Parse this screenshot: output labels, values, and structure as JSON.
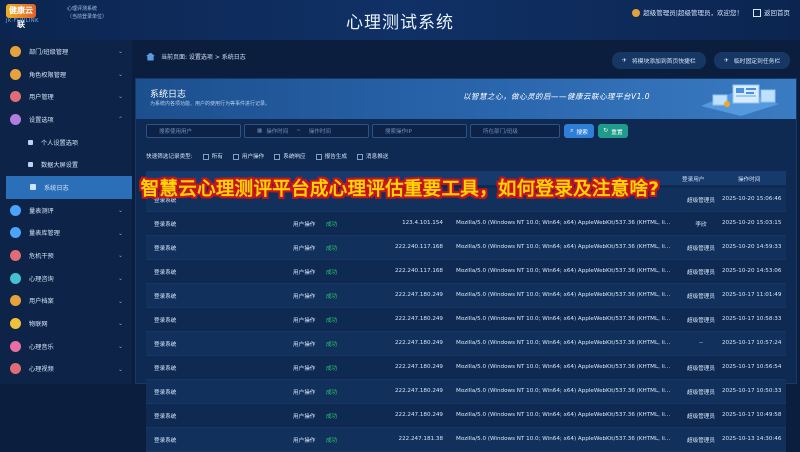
{
  "header": {
    "logo_text": "健康云联",
    "logo_sub": "JK·FUNLINK",
    "system_line1": "心理评测系统",
    "system_line2": "（当前登录单位）",
    "title": "心理测试系统",
    "user_label": "超级管理员|超级管理员，欢迎您！",
    "home_label": "返回首页"
  },
  "sidebar": {
    "items": [
      {
        "label": "部门/班级管理",
        "color": "#e6a23c"
      },
      {
        "label": "角色权限管理",
        "color": "#e6a23c"
      },
      {
        "label": "用户管理",
        "color": "#e06c75"
      },
      {
        "label": "设置选项",
        "color": "#b07de0"
      },
      {
        "label": "个人设置选项"
      },
      {
        "label": "数据大屏设置"
      },
      {
        "label": "系统日志"
      },
      {
        "label": "量表测评",
        "color": "#4aa3ff"
      },
      {
        "label": "量表库管理",
        "color": "#4aa3ff"
      },
      {
        "label": "危机干预",
        "color": "#e06c75"
      },
      {
        "label": "心理咨询",
        "color": "#45c1d0"
      },
      {
        "label": "用户档案",
        "color": "#e6a23c"
      },
      {
        "label": "物联网",
        "color": "#f0c23a"
      },
      {
        "label": "心理音乐",
        "color": "#e86fa6"
      },
      {
        "label": "心理视频",
        "color": "#e06c75"
      }
    ]
  },
  "breadcrumb": "当前页面: 设置选项 > 系统日志",
  "actions": {
    "add_shortcut": "将模块添加到首页快捷栏",
    "pin_taskbar": "临时固定到任务栏"
  },
  "banner": {
    "title": "系统日志",
    "subtitle": "为系统内各项功能、用户的使用行为等事件进行记录。",
    "slogan": "以智慧之心，做心灵的后——健康云联心理平台V1.0"
  },
  "filters": {
    "operator_placeholder": "搜索使用用户",
    "start_placeholder": "操作时间",
    "end_placeholder": "操作时间",
    "ip_placeholder": "搜索操作IP",
    "dept_placeholder": "所在部门/班级",
    "search_label": "搜索",
    "reset_label": "重置"
  },
  "quick_filter": {
    "label": "快速筛选记录类型:",
    "options": [
      "所有",
      "用户操作",
      "系统响应",
      "报告生成",
      "消息推送"
    ]
  },
  "table": {
    "headers": [
      "登录用户",
      "操作时间"
    ],
    "rows": [
      {
        "action": "登录系统",
        "type": "",
        "status": "",
        "ip": "",
        "ua": "",
        "user": "超级管理员",
        "time": "2025-10-20 15:06:46"
      },
      {
        "action": "登录系统",
        "type": "用户操作",
        "status": "成功",
        "ip": "123.4.101.154",
        "ua": "Mozilla/5.0 (Windows NT 10.0; Win64; x64) AppleWebKit/537.36 (KHTML, like Gecko)",
        "user": "李欣",
        "time": "2025-10-20 15:03:15"
      },
      {
        "action": "登录系统",
        "type": "用户操作",
        "status": "成功",
        "ip": "222.240.117.168",
        "ua": "Mozilla/5.0 (Windows NT 10.0; Win64; x64) AppleWebKit/537.36 (KHTML, like Gecko)",
        "user": "超级管理员",
        "time": "2025-10-20 14:59:33"
      },
      {
        "action": "登录系统",
        "type": "用户操作",
        "status": "成功",
        "ip": "222.240.117.168",
        "ua": "Mozilla/5.0 (Windows NT 10.0; Win64; x64) AppleWebKit/537.36 (KHTML, like Gecko)",
        "user": "超级管理员",
        "time": "2025-10-20 14:53:06"
      },
      {
        "action": "登录系统",
        "type": "用户操作",
        "status": "成功",
        "ip": "222.247.180.249",
        "ua": "Mozilla/5.0 (Windows NT 10.0; Win64; x64) AppleWebKit/537.36 (KHTML, like Gecko)",
        "user": "超级管理员",
        "time": "2025-10-17 11:01:49"
      },
      {
        "action": "登录系统",
        "type": "用户操作",
        "status": "成功",
        "ip": "222.247.180.249",
        "ua": "Mozilla/5.0 (Windows NT 10.0; Win64; x64) AppleWebKit/537.36 (KHTML, like Gecko)",
        "user": "超级管理员",
        "time": "2025-10-17 10:58:33"
      },
      {
        "action": "登录系统",
        "type": "用户操作",
        "status": "成功",
        "ip": "222.247.180.249",
        "ua": "Mozilla/5.0 (Windows NT 10.0; Win64; x64) AppleWebKit/537.36 (KHTML, like Gecko)",
        "user": "--",
        "time": "2025-10-17 10:57:24"
      },
      {
        "action": "登录系统",
        "type": "用户操作",
        "status": "成功",
        "ip": "222.247.180.249",
        "ua": "Mozilla/5.0 (Windows NT 10.0; Win64; x64) AppleWebKit/537.36 (KHTML, like Gecko)",
        "user": "超级管理员",
        "time": "2025-10-17 10:56:54"
      },
      {
        "action": "登录系统",
        "type": "用户操作",
        "status": "成功",
        "ip": "222.247.180.249",
        "ua": "Mozilla/5.0 (Windows NT 10.0; Win64; x64) AppleWebKit/537.36 (KHTML, like Gecko)",
        "user": "超级管理员",
        "time": "2025-10-17 10:50:33"
      },
      {
        "action": "登录系统",
        "type": "用户操作",
        "status": "成功",
        "ip": "222.247.180.249",
        "ua": "Mozilla/5.0 (Windows NT 10.0; Win64; x64) AppleWebKit/537.36 (KHTML, like Gecko)",
        "user": "超级管理员",
        "time": "2025-10-17 10:49:58"
      },
      {
        "action": "登录系统",
        "type": "用户操作",
        "status": "成功",
        "ip": "222.247.181.38",
        "ua": "Mozilla/5.0 (Windows NT 10.0; Win64; x64) AppleWebKit/537.36 (KHTML, like Gecko)",
        "user": "超级管理员",
        "time": "2025-10-13 14:30:46"
      }
    ]
  },
  "overlay_caption": "智慧云心理测评平台成心理评估重要工具，如何登录及注意啥?"
}
